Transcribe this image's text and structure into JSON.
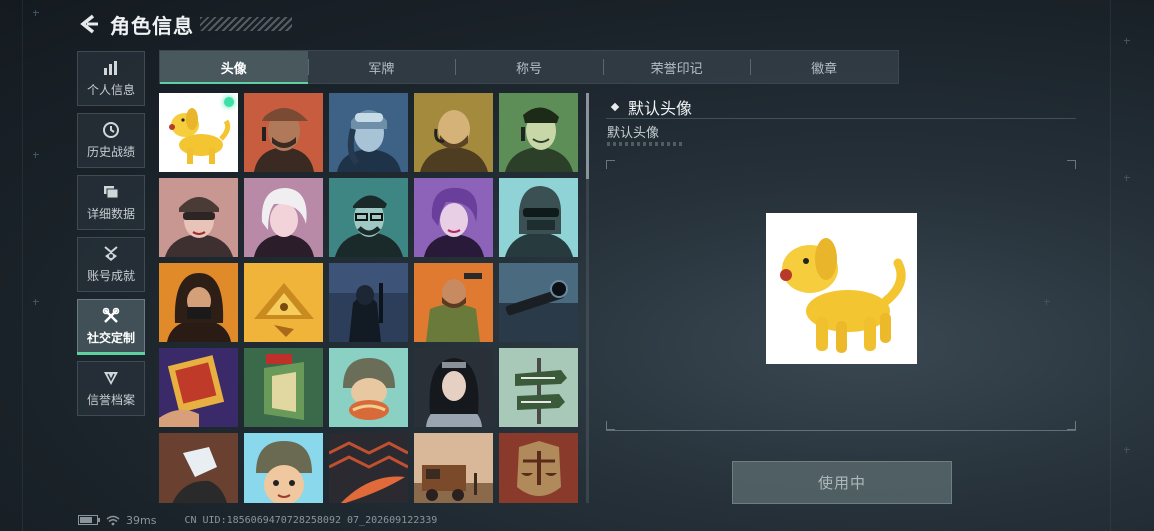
{
  "header": {
    "title": "角色信息"
  },
  "sidebar": {
    "items": [
      {
        "label": "个人信息",
        "icon": "bar-chart-icon"
      },
      {
        "label": "历史战绩",
        "icon": "clock-history-icon"
      },
      {
        "label": "详细数据",
        "icon": "folder-icon"
      },
      {
        "label": "账号成就",
        "icon": "medal-icon"
      },
      {
        "label": "社交定制",
        "icon": "wrench-icon",
        "active": true
      },
      {
        "label": "信誉档案",
        "icon": "shield-icon"
      }
    ]
  },
  "tabs": [
    {
      "label": "头像",
      "active": true
    },
    {
      "label": "军牌"
    },
    {
      "label": "称号"
    },
    {
      "label": "荣誉印记"
    },
    {
      "label": "徽章"
    }
  ],
  "avatars": [
    {
      "name": "yellow-dog",
      "selected": true
    },
    {
      "name": "soldier-cap"
    },
    {
      "name": "pilot-woman"
    },
    {
      "name": "bald-headset"
    },
    {
      "name": "smiling-headset"
    },
    {
      "name": "female-goggles"
    },
    {
      "name": "white-hair-woman"
    },
    {
      "name": "glasses-man"
    },
    {
      "name": "purple-hair-woman"
    },
    {
      "name": "masked-soldier"
    },
    {
      "name": "long-hair-mask"
    },
    {
      "name": "gold-triangle"
    },
    {
      "name": "night-soldier"
    },
    {
      "name": "bearded-soldier"
    },
    {
      "name": "sniper-scope"
    },
    {
      "name": "poster-hand"
    },
    {
      "name": "exit-door"
    },
    {
      "name": "helmet-noodles"
    },
    {
      "name": "dark-hair-woman"
    },
    {
      "name": "way-out-sign"
    },
    {
      "name": "diamond-hand"
    },
    {
      "name": "helmet-kid"
    },
    {
      "name": "feather"
    },
    {
      "name": "rusty-truck"
    },
    {
      "name": "scales-emblem"
    }
  ],
  "detail": {
    "title": "默认头像",
    "description": "默认头像"
  },
  "use_button": {
    "label": "使用中"
  },
  "status": {
    "ping": "39ms",
    "uid": "CN UID:1856069470728258092 07_202609122339"
  },
  "colors": {
    "accent": "#5fd0a2",
    "selected_dot": "#3ee0a8"
  }
}
